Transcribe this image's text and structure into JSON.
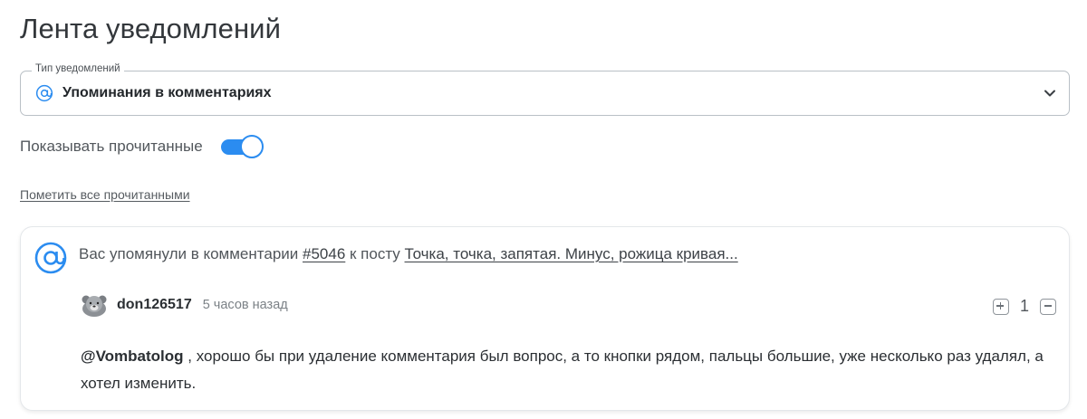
{
  "page": {
    "title": "Лента уведомлений"
  },
  "filter": {
    "legend": "Тип уведомлений",
    "selected": "Упоминания в комментариях",
    "icon": "at-icon"
  },
  "toggle": {
    "label": "Показывать прочитанные",
    "checked": true
  },
  "actions": {
    "mark_all_read": "Пометить все прочитанными"
  },
  "notification": {
    "prefix": "Вас упомянули в комментарии ",
    "comment_link": "#5046",
    "middle": " к посту ",
    "post_link": "Точка, точка, запятая. Минус, рожица кривая...",
    "author": "don126517",
    "time": "5 часов назад",
    "rating": "1",
    "mention": "@Vombatolog",
    "text": " , хорошо бы при удаление комментария был вопрос, а то кнопки рядом, пальцы большие, уже несколько раз удалял, а хотел изменить."
  },
  "colors": {
    "accent": "#2b8cf0"
  }
}
